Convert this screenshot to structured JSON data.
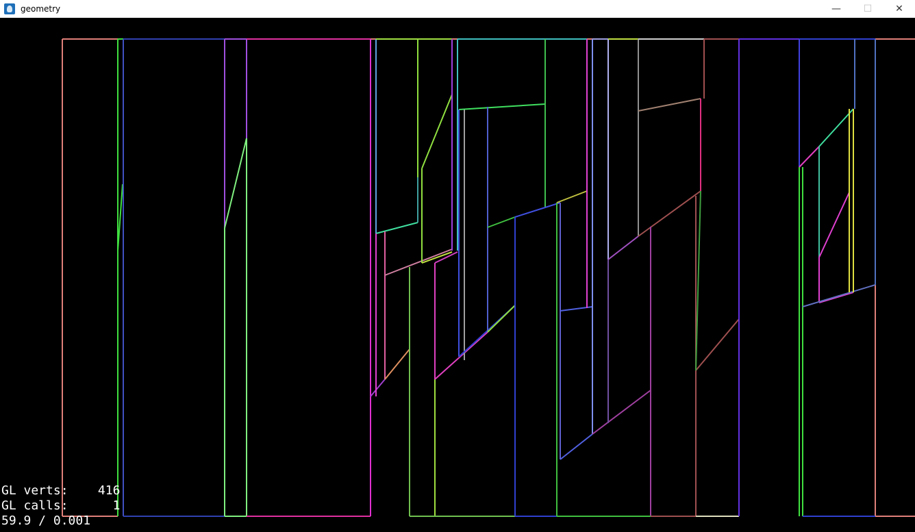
{
  "window": {
    "title": "geometry",
    "icon": "app-icon",
    "controls": {
      "minimize_icon": "minimize-icon",
      "maximize_icon": "maximize-icon",
      "close_icon": "close-icon"
    }
  },
  "stats": {
    "verts_label": "GL verts:",
    "verts_value": "416",
    "calls_label": "GL calls:",
    "calls_value": "1",
    "timing": "59.9 / 0.001"
  }
}
